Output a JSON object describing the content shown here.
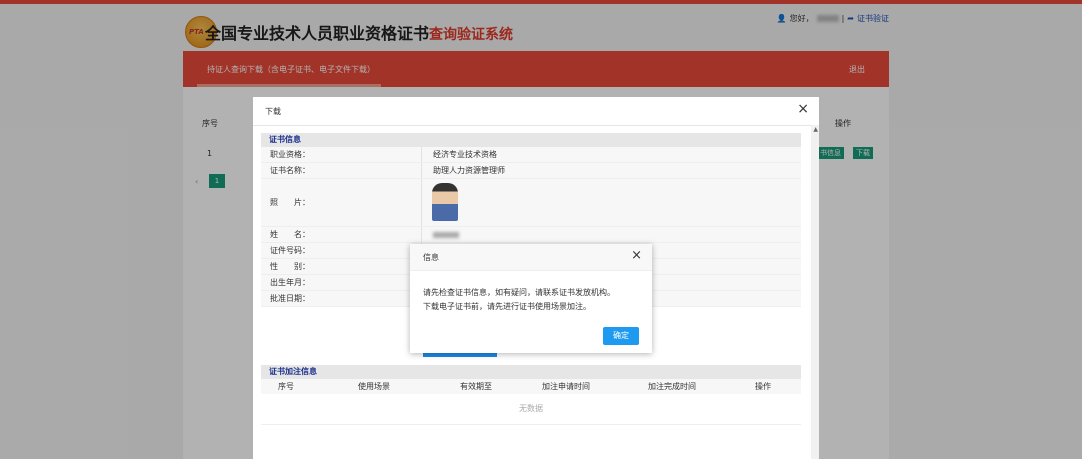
{
  "header": {
    "logo_text": "PTA",
    "title_main": "全国专业技术人员职业资格证书",
    "title_sub": "查询验证系统",
    "greeting": "您好，",
    "separator": "|",
    "verify_link": "证书验证"
  },
  "navbar": {
    "tab_label": "持证人查询下载（含电子证书、电子文件下载）",
    "exit_label": "退出"
  },
  "table": {
    "col_seq": "序号",
    "col_op": "操作",
    "row_seq": "1",
    "btn_info": "书信息",
    "btn_download": "下载",
    "page_prev": "‹",
    "current_page": "1"
  },
  "download_modal": {
    "title": "下载",
    "close": "×",
    "cert_section": "证书信息",
    "rows": [
      {
        "label": "职业资格：",
        "value": "经济专业技术资格"
      },
      {
        "label": "证书名称：",
        "value": "助理人力资源管理师"
      }
    ],
    "photo_label": "照　　片：",
    "rows2": [
      {
        "label": "姓　　名："
      },
      {
        "label": "证件号码："
      },
      {
        "label": "性　　别："
      },
      {
        "label": "出生年月："
      },
      {
        "label": "批准日期："
      }
    ],
    "reg_section": "证书加注信息",
    "reg_columns": [
      "序号",
      "使用场景",
      "有效期至",
      "加注申请时间",
      "加注完成时间",
      "操作"
    ],
    "no_data": "无数据"
  },
  "info_dialog": {
    "title": "信息",
    "close": "×",
    "line1": "请先检查证书信息，如有疑问，请联系证书发放机构。",
    "line2": "下载电子证书前，请先进行证书使用场景加注。",
    "ok": "确定"
  }
}
